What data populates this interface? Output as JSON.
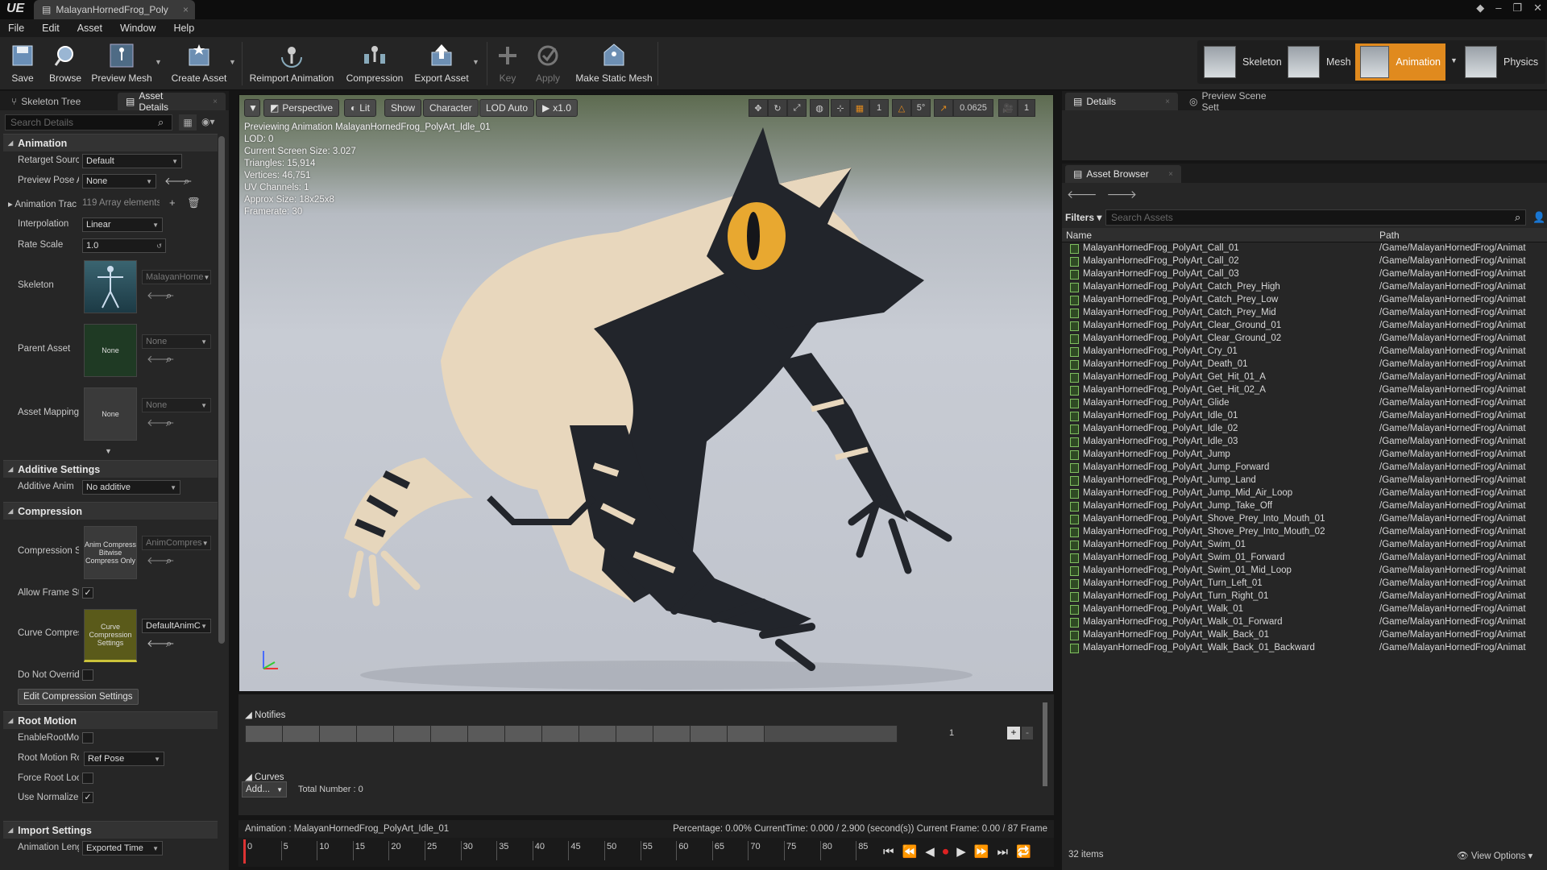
{
  "window": {
    "tab_title": "MalayanHornedFrog_Poly",
    "logo": "UE"
  },
  "menu": [
    "File",
    "Edit",
    "Asset",
    "Window",
    "Help"
  ],
  "toolbar": {
    "buttons": [
      {
        "label": "Save",
        "icon": "save-icon"
      },
      {
        "label": "Browse",
        "icon": "browse-icon"
      },
      {
        "label": "Preview Mesh",
        "icon": "preview-mesh-icon"
      },
      {
        "label": "Create Asset",
        "icon": "create-asset-icon"
      },
      {
        "label": "Reimport Animation",
        "icon": "reimport-icon"
      },
      {
        "label": "Compression",
        "icon": "compression-icon"
      },
      {
        "label": "Export Asset",
        "icon": "export-icon"
      },
      {
        "label": "Key",
        "icon": "key-icon"
      },
      {
        "label": "Apply",
        "icon": "apply-icon"
      },
      {
        "label": "Make Static Mesh",
        "icon": "static-mesh-icon"
      }
    ]
  },
  "modes": [
    {
      "label": "Skeleton"
    },
    {
      "label": "Mesh"
    },
    {
      "label": "Animation",
      "active": true
    },
    {
      "label": "Physics"
    }
  ],
  "left_tabs": [
    {
      "label": "Skeleton Tree"
    },
    {
      "label": "Asset Details"
    }
  ],
  "details_search_placeholder": "Search Details",
  "categories": {
    "animation": "Animation",
    "additive": "Additive Settings",
    "compression": "Compression",
    "root_motion": "Root Motion",
    "import": "Import Settings"
  },
  "props": {
    "retarget_label": "Retarget Sourc",
    "retarget_val": "Default",
    "preview_pose_label": "Preview Pose A",
    "preview_pose_val": "None",
    "anim_track_label": "Animation Trac",
    "anim_track_val": "119 Array elements",
    "interp_label": "Interpolation",
    "interp_val": "Linear",
    "rate_label": "Rate Scale",
    "rate_val": "1.0",
    "skeleton_label": "Skeleton",
    "skeleton_val": "MalayanHorne",
    "parent_label": "Parent Asset",
    "parent_val": "None",
    "parent_thumb": "None",
    "mapping_label": "Asset Mapping",
    "mapping_val": "None",
    "mapping_thumb": "None",
    "additive_label": "Additive Anim",
    "additive_val": "No additive",
    "comp_scheme_label": "Compression S",
    "comp_scheme_val": "AnimCompres",
    "comp_thumb": "Anim Compress Bitwise Compress Only",
    "allow_frame_label": "Allow Frame St",
    "curve_comp_label": "Curve Compres",
    "curve_comp_val": "DefaultAnimC",
    "curve_thumb": "Curve Compression Settings",
    "do_not_override_label": "Do Not Overrid",
    "edit_comp_btn": "Edit Compression Settings",
    "enable_root_label": "EnableRootMot",
    "root_lock_label": "Root Motion Ro",
    "root_lock_val": "Ref Pose",
    "force_root_label": "Force Root Loc",
    "use_norm_label": "Use Normalize",
    "anim_len_label": "Animation Leng",
    "anim_len_val": "Exported Time"
  },
  "viewport": {
    "buttons": {
      "perspective": "Perspective",
      "lit": "Lit",
      "show": "Show",
      "character": "Character",
      "lod": "LOD Auto",
      "speed": "x1.0"
    },
    "snap": {
      "grid": "1",
      "angle": "5°",
      "scale": "0.0625",
      "cam": "1"
    },
    "info": [
      "Previewing Animation MalayanHornedFrog_PolyArt_Idle_01",
      "LOD: 0",
      "Current Screen Size: 3.027",
      "Triangles: 15,914",
      "Vertices: 46,751",
      "UV Channels: 1",
      "Approx Size: 18x25x8",
      "Framerate: 30"
    ]
  },
  "timeline": {
    "notifies": "Notifies",
    "track_num": "1",
    "curves": "Curves",
    "add": "Add...",
    "total": "Total Number : 0",
    "anim_name": "Animation :  MalayanHornedFrog_PolyArt_Idle_01",
    "status": "Percentage:  0.00% CurrentTime:  0.000 / 2.900 (second(s)) Current Frame:  0.00 / 87 Frame",
    "ticks": [
      "0",
      "5",
      "10",
      "15",
      "20",
      "25",
      "30",
      "35",
      "40",
      "45",
      "50",
      "55",
      "60",
      "65",
      "70",
      "75",
      "80",
      "85"
    ]
  },
  "right_tabs": [
    {
      "label": "Details"
    },
    {
      "label": "Preview Scene Sett"
    }
  ],
  "asset_browser": {
    "tab": "Asset Browser",
    "filters": "Filters",
    "search_placeholder": "Search Assets",
    "col_name": "Name",
    "col_path": "Path",
    "rows": [
      {
        "name": "MalayanHornedFrog_PolyArt_Call_01",
        "path": "/Game/MalayanHornedFrog/Animat"
      },
      {
        "name": "MalayanHornedFrog_PolyArt_Call_02",
        "path": "/Game/MalayanHornedFrog/Animat"
      },
      {
        "name": "MalayanHornedFrog_PolyArt_Call_03",
        "path": "/Game/MalayanHornedFrog/Animat"
      },
      {
        "name": "MalayanHornedFrog_PolyArt_Catch_Prey_High",
        "path": "/Game/MalayanHornedFrog/Animat"
      },
      {
        "name": "MalayanHornedFrog_PolyArt_Catch_Prey_Low",
        "path": "/Game/MalayanHornedFrog/Animat"
      },
      {
        "name": "MalayanHornedFrog_PolyArt_Catch_Prey_Mid",
        "path": "/Game/MalayanHornedFrog/Animat"
      },
      {
        "name": "MalayanHornedFrog_PolyArt_Clear_Ground_01",
        "path": "/Game/MalayanHornedFrog/Animat"
      },
      {
        "name": "MalayanHornedFrog_PolyArt_Clear_Ground_02",
        "path": "/Game/MalayanHornedFrog/Animat"
      },
      {
        "name": "MalayanHornedFrog_PolyArt_Cry_01",
        "path": "/Game/MalayanHornedFrog/Animat"
      },
      {
        "name": "MalayanHornedFrog_PolyArt_Death_01",
        "path": "/Game/MalayanHornedFrog/Animat"
      },
      {
        "name": "MalayanHornedFrog_PolyArt_Get_Hit_01_A",
        "path": "/Game/MalayanHornedFrog/Animat"
      },
      {
        "name": "MalayanHornedFrog_PolyArt_Get_Hit_02_A",
        "path": "/Game/MalayanHornedFrog/Animat"
      },
      {
        "name": "MalayanHornedFrog_PolyArt_Glide",
        "path": "/Game/MalayanHornedFrog/Animat"
      },
      {
        "name": "MalayanHornedFrog_PolyArt_Idle_01",
        "path": "/Game/MalayanHornedFrog/Animat"
      },
      {
        "name": "MalayanHornedFrog_PolyArt_Idle_02",
        "path": "/Game/MalayanHornedFrog/Animat"
      },
      {
        "name": "MalayanHornedFrog_PolyArt_Idle_03",
        "path": "/Game/MalayanHornedFrog/Animat"
      },
      {
        "name": "MalayanHornedFrog_PolyArt_Jump",
        "path": "/Game/MalayanHornedFrog/Animat"
      },
      {
        "name": "MalayanHornedFrog_PolyArt_Jump_Forward",
        "path": "/Game/MalayanHornedFrog/Animat"
      },
      {
        "name": "MalayanHornedFrog_PolyArt_Jump_Land",
        "path": "/Game/MalayanHornedFrog/Animat"
      },
      {
        "name": "MalayanHornedFrog_PolyArt_Jump_Mid_Air_Loop",
        "path": "/Game/MalayanHornedFrog/Animat"
      },
      {
        "name": "MalayanHornedFrog_PolyArt_Jump_Take_Off",
        "path": "/Game/MalayanHornedFrog/Animat"
      },
      {
        "name": "MalayanHornedFrog_PolyArt_Shove_Prey_Into_Mouth_01",
        "path": "/Game/MalayanHornedFrog/Animat"
      },
      {
        "name": "MalayanHornedFrog_PolyArt_Shove_Prey_Into_Mouth_02",
        "path": "/Game/MalayanHornedFrog/Animat"
      },
      {
        "name": "MalayanHornedFrog_PolyArt_Swim_01",
        "path": "/Game/MalayanHornedFrog/Animat"
      },
      {
        "name": "MalayanHornedFrog_PolyArt_Swim_01_Forward",
        "path": "/Game/MalayanHornedFrog/Animat"
      },
      {
        "name": "MalayanHornedFrog_PolyArt_Swim_01_Mid_Loop",
        "path": "/Game/MalayanHornedFrog/Animat"
      },
      {
        "name": "MalayanHornedFrog_PolyArt_Turn_Left_01",
        "path": "/Game/MalayanHornedFrog/Animat"
      },
      {
        "name": "MalayanHornedFrog_PolyArt_Turn_Right_01",
        "path": "/Game/MalayanHornedFrog/Animat"
      },
      {
        "name": "MalayanHornedFrog_PolyArt_Walk_01",
        "path": "/Game/MalayanHornedFrog/Animat"
      },
      {
        "name": "MalayanHornedFrog_PolyArt_Walk_01_Forward",
        "path": "/Game/MalayanHornedFrog/Animat"
      },
      {
        "name": "MalayanHornedFrog_PolyArt_Walk_Back_01",
        "path": "/Game/MalayanHornedFrog/Animat"
      },
      {
        "name": "MalayanHornedFrog_PolyArt_Walk_Back_01_Backward",
        "path": "/Game/MalayanHornedFrog/Animat"
      }
    ],
    "count": "32 items",
    "view_options": "View Options"
  },
  "colors": {
    "accent": "#e08a1e",
    "record": "#dd2222"
  }
}
